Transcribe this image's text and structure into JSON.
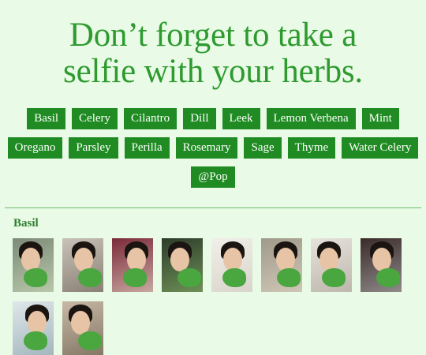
{
  "headline": {
    "line1": "Don’t forget to take a",
    "line2": "selfie with your herbs."
  },
  "tags": [
    [
      "Basil",
      "Celery",
      "Cilantro",
      "Dill",
      "Leek",
      "Lemon Verbena",
      "Mint"
    ],
    [
      "Oregano",
      "Parsley",
      "Perilla",
      "Rosemary",
      "Sage",
      "Thyme",
      "Water Celery"
    ],
    [
      "@Pop"
    ]
  ],
  "section": {
    "title": "Basil",
    "photo_count": 10
  },
  "colors": {
    "background": "#e9fbe6",
    "headline": "#2e9a30",
    "tag_bg": "#1f8b22",
    "tag_text": "#ffffff",
    "section_title": "#2e7d2f",
    "divider": "#6cb96a"
  }
}
